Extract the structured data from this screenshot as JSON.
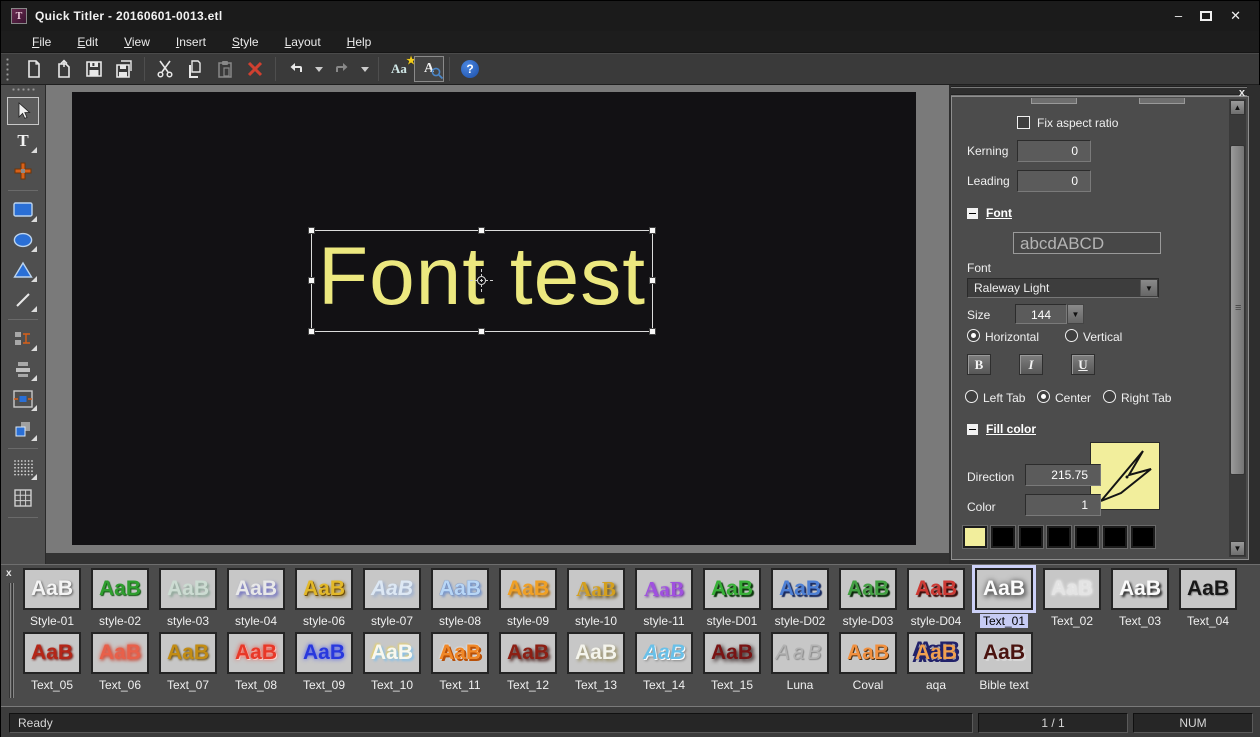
{
  "window": {
    "title": "Quick Titler - 20160601-0013.etl",
    "icon": "app-icon-T",
    "controls": {
      "minimize": "–",
      "maximize": "maximize-box",
      "close": "✕"
    }
  },
  "menu": {
    "items": [
      "File",
      "Edit",
      "View",
      "Insert",
      "Style",
      "Layout",
      "Help"
    ]
  },
  "toolbar": {
    "buttons": [
      {
        "icon": "new-document-icon"
      },
      {
        "icon": "open-template-icon"
      },
      {
        "icon": "save-icon"
      },
      {
        "icon": "save-as-icon"
      },
      {
        "sep": true
      },
      {
        "icon": "cut-icon"
      },
      {
        "icon": "copy-icon"
      },
      {
        "icon": "paste-icon",
        "enabled": false
      },
      {
        "icon": "delete-icon"
      },
      {
        "sep": true
      },
      {
        "icon": "undo-icon"
      },
      {
        "icon": "undo-dropdown-icon",
        "narrow": true
      },
      {
        "icon": "redo-icon",
        "enabled": false
      },
      {
        "icon": "redo-dropdown-icon",
        "narrow": true
      },
      {
        "sep": true
      },
      {
        "icon": "text-style-icon"
      },
      {
        "icon": "font-preview-icon",
        "active": true
      },
      {
        "sep": true
      },
      {
        "icon": "help-icon"
      }
    ]
  },
  "tool_palette": {
    "tools": [
      {
        "name": "select-tool",
        "selected": true
      },
      {
        "name": "text-tool",
        "flyout": true
      },
      {
        "name": "transform-tool"
      },
      {
        "sep": true
      },
      {
        "name": "rectangle-tool",
        "flyout": true
      },
      {
        "name": "ellipse-tool",
        "flyout": true
      },
      {
        "name": "triangle-tool",
        "flyout": true
      },
      {
        "name": "line-tool",
        "flyout": true
      },
      {
        "sep": true
      },
      {
        "name": "object-properties-tool",
        "flyout": true
      },
      {
        "name": "align-tool",
        "flyout": true
      },
      {
        "name": "center-object-tool",
        "flyout": true
      },
      {
        "name": "layer-order-tool",
        "flyout": true
      },
      {
        "sep": true
      },
      {
        "name": "grid-dots-tool",
        "flyout": true
      },
      {
        "name": "safe-area-grid-tool"
      },
      {
        "sep": true
      }
    ]
  },
  "canvas": {
    "text": "Font test",
    "text_color": "#ece87f",
    "background": "#121114"
  },
  "properties_panel": {
    "close_label": "x",
    "fix_aspect_ratio_label": "Fix aspect ratio",
    "kerning": {
      "label": "Kerning",
      "value": "0"
    },
    "leading": {
      "label": "Leading",
      "value": "0"
    },
    "font_section": {
      "title": "Font",
      "preview_text": "abcdABCD",
      "font_label": "Font",
      "font_value": "Raleway Light",
      "size_label": "Size",
      "size_value": "144",
      "orientation_horizontal": "Horizontal",
      "orientation_vertical": "Vertical",
      "orientation_selected": "Horizontal",
      "bold_label": "B",
      "italic_label": "I",
      "underline_label": "U",
      "tab_left": "Left Tab",
      "tab_center": "Center",
      "tab_right": "Right Tab",
      "tab_selected": "Center"
    },
    "fill_section": {
      "title": "Fill color",
      "direction": {
        "label": "Direction",
        "value": "215.75"
      },
      "color": {
        "label": "Color",
        "value": "1"
      },
      "preview_color": "#f2ee9c",
      "swatches": [
        "#f2ee9c",
        "#000000",
        "#000000",
        "#000000",
        "#000000",
        "#000000",
        "#000000"
      ]
    }
  },
  "style_gallery": {
    "close_label": "x",
    "sample_text": "AaB",
    "rows": [
      [
        {
          "label": "Style-01",
          "color": "#f4f4f4",
          "shadow": "1px 1px 2px #5a5a5a"
        },
        {
          "label": "style-02",
          "color": "#2f9e2f",
          "shadow": "1px 1px 1px #135813"
        },
        {
          "label": "style-03",
          "color": "#ccdcd2",
          "shadow": "2px 2px 2px #8fa89a"
        },
        {
          "label": "style-04",
          "color": "#9а9ae8",
          "shadow": "2px 2px 3px #6666c0"
        },
        {
          "label": "style-06",
          "color": "#e2b829",
          "shadow": "1px 1px 0 #6e4e0c, 2px 2px 3px #8a6a1a"
        },
        {
          "label": "style-07",
          "color": "#dde8f4",
          "shadow": "2px 2px 3px #96acd0",
          "italic": true
        },
        {
          "label": "style-08",
          "color": "#b8d6f6",
          "shadow": "0 0 1px #2a58b0, 2px 2px 2px #7a96c8"
        },
        {
          "label": "style-09",
          "color": "#f0a024",
          "shadow": "2px 2px 2px #a86a10"
        },
        {
          "label": "style-10",
          "color": "#d4a01e",
          "shadow": "2px 2px 3px #584208",
          "serif": true
        },
        {
          "label": "style-11",
          "color": "#a050e0",
          "shadow": "1px 1px 2px #6a28a0",
          "serif": true
        },
        {
          "label": "style-D01",
          "color": "#38b038",
          "shadow": "2px 2px 1px #0c380c"
        },
        {
          "label": "style-D02",
          "color": "#4d7fd4",
          "shadow": "2px 2px 1px #182a60"
        },
        {
          "label": "style-D03",
          "color": "#42a042",
          "shadow": "2px 2px 1px #0a2a0a"
        },
        {
          "label": "style-D04",
          "color": "#cc3a34",
          "shadow": "2px 2px 1px #3c0c0a"
        },
        {
          "label": "Text_01",
          "color": "#fcfcfc",
          "shadow": "0 0 6px #555555, 2px 2px 5px #484848",
          "selected": true
        },
        {
          "label": "Text_02",
          "color": "#e4e4e4",
          "shadow": "0 0 3px #ffffff"
        },
        {
          "label": "Text_03",
          "color": "#fafafa",
          "shadow": "2px 2px 2px #262626"
        },
        {
          "label": "Text_04",
          "color": "#181818",
          "shadow": "1px 1px 1px #8a8a8a"
        }
      ],
      [
        {
          "label": "Text_05",
          "color": "#b42618",
          "shadow": "1px 1px 2px #700f08"
        },
        {
          "label": "Text_06",
          "color": "#e8604a",
          "shadow": "0 0 5px #e8604a, 1px 1px 3px #b03020"
        },
        {
          "label": "Text_07",
          "color": "#c28c14",
          "shadow": "1px 1px 2px #5e4206"
        },
        {
          "label": "Text_08",
          "color": "#e83828",
          "shadow": "0 0 5px #f04030, 1px 1px 0 #ffffff"
        },
        {
          "label": "Text_09",
          "color": "#2838dd",
          "shadow": "0 0 5px #4050f0"
        },
        {
          "label": "Text_10",
          "color": "#f8f8f0",
          "shadow": "2px 2px 2px #88c0e8, -1px -1px 2px #e8d060"
        },
        {
          "label": "Text_11",
          "color": "#f08828",
          "shadow": "2px 2px 0 #b85008, 0 0 2px #ffffff"
        },
        {
          "label": "Text_12",
          "color": "#8c1f14",
          "shadow": "2px 2px 3px #3a0c08"
        },
        {
          "label": "Text_13",
          "color": "#f4f4ec",
          "shadow": "2px 2px 3px #968c60"
        },
        {
          "label": "Text_14",
          "color": "#6ac0e8",
          "shadow": "1px 1px 0 #ffffff, 2px 2px 2px #888888",
          "italic": true
        },
        {
          "label": "Text_15",
          "color": "#781414",
          "shadow": "2px 2px 4px #1a0404"
        },
        {
          "label": "Luna",
          "color": "#b2b2b2",
          "shadow": "1px 1px 1px #8a8a8a",
          "italic": true,
          "spaced": true
        },
        {
          "label": "Coval",
          "color": "#f09040",
          "shadow": "1px 1px 0 #503010"
        },
        {
          "label": "aqa",
          "color": "#f0a050",
          "shadow": "3px 3px 0 #22226a, -3px 3px 0 #22226a, 3px -3px 0 #22226a, -3px -3px 0 #22226a, 0 0 2px #1a1a50"
        },
        {
          "label": "Bible text",
          "color": "#4a1410",
          "shadow": "2px 2px 0 #d8d8d8"
        }
      ]
    ]
  },
  "status_bar": {
    "ready": "Ready",
    "page": "1 / 1",
    "num": "NUM"
  }
}
